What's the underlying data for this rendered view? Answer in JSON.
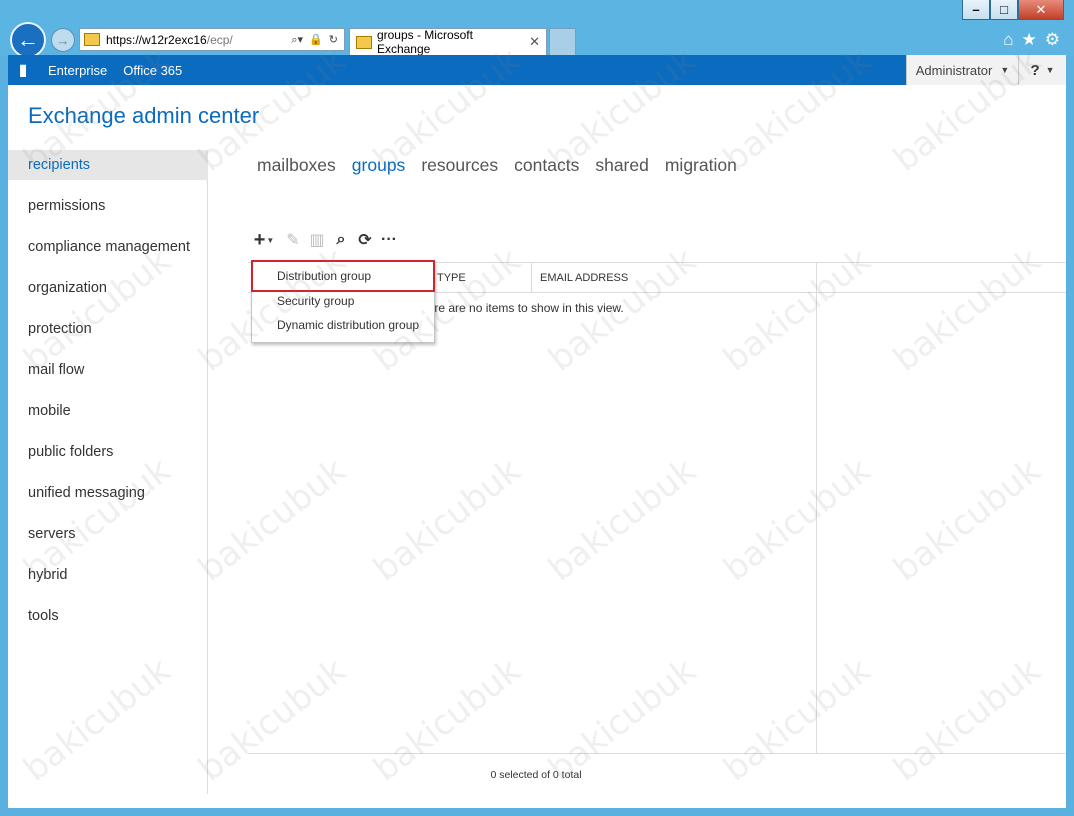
{
  "browser": {
    "url_host": "https://w12r2exc16",
    "url_path": "/ecp/",
    "tab_title": "groups - Microsoft Exchange",
    "window_buttons": {
      "minimize": "–",
      "maximize": "□",
      "close": "✕"
    }
  },
  "topbar": {
    "enterprise": "Enterprise",
    "office365": "Office 365",
    "user": "Administrator",
    "help": "?"
  },
  "page": {
    "title": "Exchange admin center"
  },
  "leftnav": {
    "items": [
      {
        "label": "recipients",
        "active": true
      },
      {
        "label": "permissions"
      },
      {
        "label": "compliance management"
      },
      {
        "label": "organization"
      },
      {
        "label": "protection"
      },
      {
        "label": "mail flow"
      },
      {
        "label": "mobile"
      },
      {
        "label": "public folders"
      },
      {
        "label": "unified messaging"
      },
      {
        "label": "servers"
      },
      {
        "label": "hybrid"
      },
      {
        "label": "tools"
      }
    ]
  },
  "subtabs": [
    {
      "label": "mailboxes"
    },
    {
      "label": "groups",
      "active": true
    },
    {
      "label": "resources"
    },
    {
      "label": "contacts"
    },
    {
      "label": "shared"
    },
    {
      "label": "migration"
    }
  ],
  "toolbar": {
    "icons": [
      "add-icon",
      "edit-icon",
      "delete-icon",
      "search-icon",
      "refresh-icon",
      "more-icon"
    ]
  },
  "grid": {
    "columns": [
      "TYPE",
      "EMAIL ADDRESS"
    ],
    "empty_message": "here are no items to show in this view.",
    "status": "0 selected of 0 total"
  },
  "add_menu": {
    "items": [
      "Distribution group",
      "Security group",
      "Dynamic distribution group"
    ],
    "highlighted": "Distribution group"
  },
  "watermark": "bakicubuk",
  "colors": {
    "accent": "#0b6bbf",
    "highlight_border": "#d2242c",
    "chrome": "#5bb4e2"
  }
}
